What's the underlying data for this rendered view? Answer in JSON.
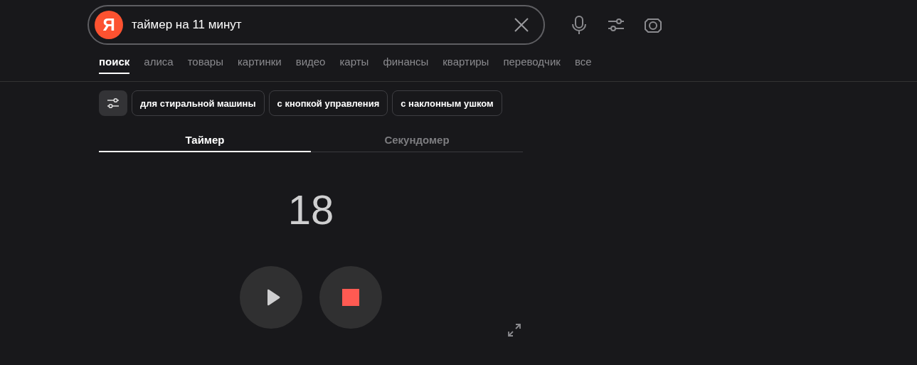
{
  "search": {
    "logo": "Я",
    "query": "таймер на 11 минут"
  },
  "nav_tabs": [
    {
      "label": "поиск",
      "selected": true
    },
    {
      "label": "алиса",
      "selected": false
    },
    {
      "label": "товары",
      "selected": false
    },
    {
      "label": "картинки",
      "selected": false
    },
    {
      "label": "видео",
      "selected": false
    },
    {
      "label": "карты",
      "selected": false
    },
    {
      "label": "финансы",
      "selected": false
    },
    {
      "label": "квартиры",
      "selected": false
    },
    {
      "label": "переводчик",
      "selected": false
    },
    {
      "label": "все",
      "selected": false
    }
  ],
  "chips": [
    "для стиральной машины",
    "с кнопкой управления",
    "с наклонным ушком"
  ],
  "timer": {
    "tabs": [
      {
        "label": "Таймер",
        "selected": true
      },
      {
        "label": "Секундомер",
        "selected": false
      }
    ],
    "display": "18"
  }
}
